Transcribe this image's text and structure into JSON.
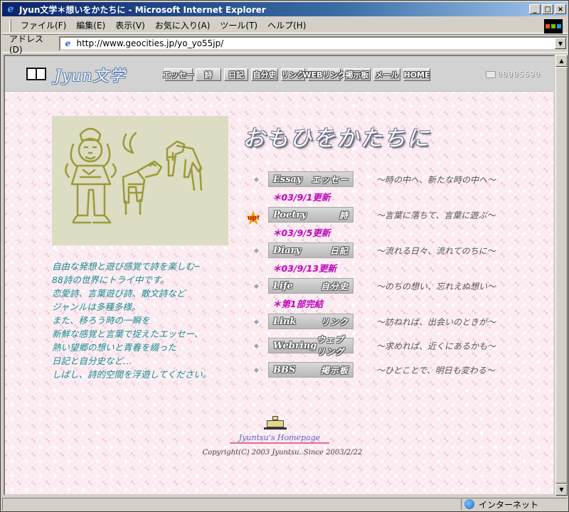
{
  "window": {
    "title": "Jyun文学＊想いをかたちに - Microsoft Internet Explorer",
    "minimize": "_",
    "maximize": "□",
    "close": "×"
  },
  "menubar": {
    "items": [
      "ファイル(F)",
      "編集(E)",
      "表示(V)",
      "お気に入り(A)",
      "ツール(T)",
      "ヘルプ(H)"
    ]
  },
  "addressbar": {
    "label": "アドレス(D)",
    "url": "http://www.geocities.jp/yo_yo55jp/"
  },
  "header": {
    "logo": "Jyun文学",
    "nav": [
      "エッセー",
      "詩",
      "日記",
      "自分史",
      "リンク",
      "WEBリング",
      "掲示板",
      "メール",
      "HOME"
    ],
    "counter": "00005690"
  },
  "site_title": "おもひをかたちに",
  "intro_lines": [
    "自由な発想と遊び感覚で詩を楽しむ─",
    "88詩の世界にトライ中です。",
    "恋愛詩、言葉遊び詩、散文詩など",
    "ジャンルは多種多様。",
    "また、移ろう時の一瞬を",
    "新鮮な感覚と言葉で捉えたエッセー、",
    "熱い望郷の想いと青春を綴った",
    "日記と自分史など…",
    "しばし、詩的空間を浮遊してください。"
  ],
  "sections": [
    {
      "en": "Essay",
      "ja": "エッセー",
      "desc": "～時の中へ、新たな時の中へ～",
      "update": "＊03/9/1更新",
      "up": false
    },
    {
      "en": "Poetry",
      "ja": "詩",
      "desc": "～言葉に落ちて、言葉に遊ぶ～",
      "update": "＊03/9/5更新",
      "up": true,
      "up_label": "up!"
    },
    {
      "en": "Diary",
      "ja": "日記",
      "desc": "～流れる日々、流れてのちに～",
      "update": "＊03/9/13更新",
      "up": false
    },
    {
      "en": "Life",
      "ja": "自分史",
      "desc": "～のちの想い、忘れえぬ想い～",
      "update": "＊第1部完結",
      "up": false
    },
    {
      "en": "Link",
      "ja": "リンク",
      "desc": "～訪ねれば、出会いのときが～",
      "update": "",
      "up": false
    },
    {
      "en": "Webring",
      "ja": "ウェブリング",
      "desc": "～求めれば、近くにあるかも～",
      "update": "",
      "up": false
    },
    {
      "en": "BBS",
      "ja": "掲示板",
      "desc": "～ひとことで、明日も変わる～",
      "update": "",
      "up": false
    }
  ],
  "footer": {
    "name": "Jyuntsu's Homepage",
    "copyright": "Copyright(C) 2003 Jyuntsu. Since 2003/2/22"
  },
  "statusbar": {
    "zone": "インターネット"
  },
  "colors": {
    "intro_text": "#178a8f",
    "update_text": "#c000c0",
    "page_bg": "#fbe9f0"
  }
}
